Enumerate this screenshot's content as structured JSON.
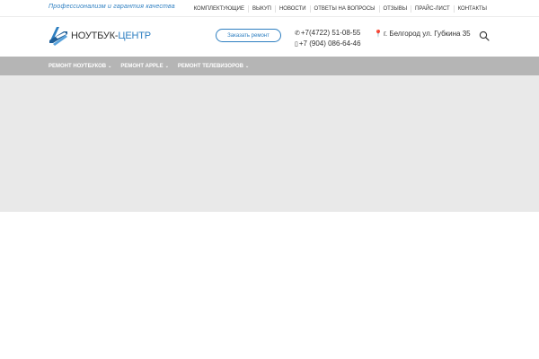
{
  "topbar": {
    "tagline": "Профессионализм и гарантия качества",
    "links": [
      "КОМПЛЕКТУЮЩИЕ",
      "ВЫКУП",
      "НОВОСТИ",
      "ОТВЕТЫ НА ВОПРОСЫ",
      "ОТЗЫВЫ",
      "ПРАЙС-ЛИСТ",
      "КОНТАКТЫ"
    ]
  },
  "header": {
    "logo": {
      "name_part1": "НОУТБУК-",
      "name_part2": "ЦЕНТР",
      "icon": "laptop-logo-icon"
    },
    "order_button": "Заказать ремонт",
    "phones": [
      "+7(4722) 51-08-55",
      "+7 (904) 086-64-46"
    ],
    "phone_icons": [
      "phone-icon",
      "mobile-icon"
    ],
    "address": "г. Белгород ул. Губкина 35",
    "address_icon": "map-pin-icon",
    "search_icon": "search-icon"
  },
  "menu": {
    "items": [
      "РЕМОНТ НОУТБУКОВ",
      "РЕМОНТ APPLE",
      "РЕМОНТ ТЕЛЕВИЗОРОВ"
    ]
  },
  "colors": {
    "accent": "#2e7fc1",
    "menubar": "#b5b5b5",
    "hero": "#e9e9e9"
  }
}
